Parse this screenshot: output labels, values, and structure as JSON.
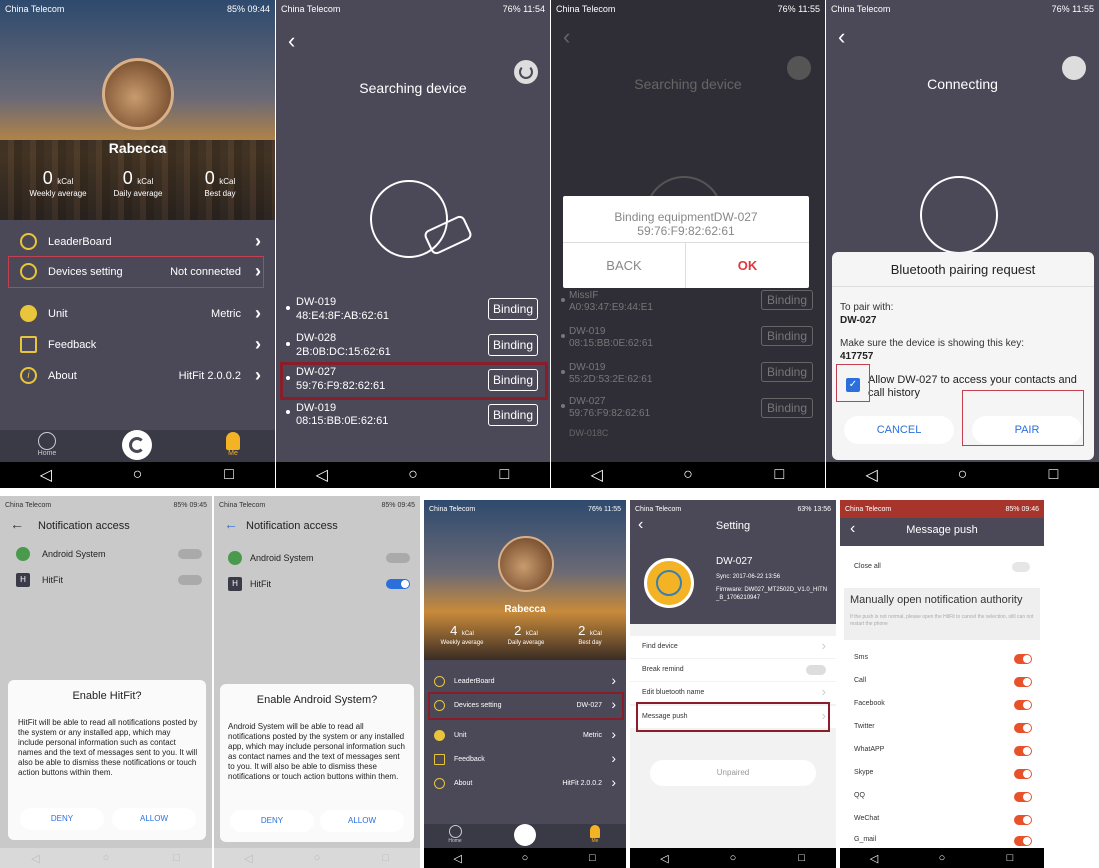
{
  "s1": {
    "status_left": "China Telecom",
    "status_right": "85% 09:44",
    "username": "Rabecca",
    "stats": [
      {
        "value": "0",
        "unit": "kCal",
        "label": "Weekly average"
      },
      {
        "value": "0",
        "unit": "kCal",
        "label": "Daily average"
      },
      {
        "value": "0",
        "unit": "kCal",
        "label": "Best day"
      }
    ],
    "menu": [
      {
        "label": "LeaderBoard",
        "value": ""
      },
      {
        "label": "Devices setting",
        "value": "Not connected"
      },
      {
        "label": "Unit",
        "value": "Metric"
      },
      {
        "label": "Feedback",
        "value": ""
      },
      {
        "label": "About",
        "value": "HitFit 2.0.0.2"
      }
    ],
    "tab_home": "Home",
    "tab_me": "Me"
  },
  "s2": {
    "status_left": "China Telecom",
    "status_right": "76% 11:54",
    "title": "Searching device",
    "binding": "Binding",
    "devices": [
      {
        "name": "DW-019",
        "mac": "48:E4:8F:AB:62:61"
      },
      {
        "name": "DW-028",
        "mac": "2B:0B:DC:15:62:61"
      },
      {
        "name": "DW-027",
        "mac": "59:76:F9:82:62:61"
      },
      {
        "name": "DW-019",
        "mac": "08:15:BB:0E:62:61"
      }
    ]
  },
  "s3": {
    "status_left": "China Telecom",
    "status_right": "76% 11:55",
    "title": "Searching device",
    "dialog_line1": "Binding equipmentDW-027",
    "dialog_line2": "59:76:F9:82:62:61",
    "back": "BACK",
    "ok": "OK",
    "binding": "Binding",
    "devices": [
      {
        "name": "MissIF",
        "mac": "A0:93:47:E9:44:E1"
      },
      {
        "name": "DW-019",
        "mac": "08:15:BB:0E:62:61"
      },
      {
        "name": "DW-019",
        "mac": "55:2D:53:2E:62:61"
      },
      {
        "name": "DW-027",
        "mac": "59:76:F9:82:62:61"
      },
      {
        "name": "DW-018C",
        "mac": ""
      }
    ]
  },
  "s4": {
    "status_left": "China Telecom",
    "status_right": "76% 11:55",
    "title": "Connecting",
    "dialog_title": "Bluetooth pairing request",
    "to_pair": "To pair with:",
    "device": "DW-027",
    "make_sure": "Make sure the device is showing this key:",
    "key": "417757",
    "allow": "Allow DW-027 to access your contacts and call history",
    "cancel": "CANCEL",
    "pair": "PAIR"
  },
  "s5": {
    "status_left": "China Telecom",
    "status_right": "85% 09:45",
    "header": "Notification access",
    "apps": [
      "Android System",
      "HitFit"
    ],
    "dialog_title": "Enable HitFit?",
    "dialog_body": "HitFit will be able to read all notifications posted by the system or any installed app, which may include personal information such as contact names and the text of messages sent to you. It will also be able to dismiss these notifications or touch action buttons within them.",
    "deny": "DENY",
    "allow": "ALLOW"
  },
  "s6": {
    "status_left": "China Telecom",
    "status_right": "85% 09:45",
    "header": "Notification access",
    "apps": [
      "Android System",
      "HitFit"
    ],
    "dialog_title": "Enable Android System?",
    "dialog_body": "Android System will be able to read all notifications posted by the system or any installed app, which may include personal information such as contact names and the text of messages sent to you. It will also be able to dismiss these notifications or touch action buttons within them.",
    "deny": "DENY",
    "allow": "ALLOW"
  },
  "s7": {
    "status_left": "China Telecom",
    "status_right": "76% 11:55",
    "username": "Rabecca",
    "stats": [
      {
        "value": "4",
        "unit": "kCal",
        "label": "Weekly average"
      },
      {
        "value": "2",
        "unit": "kCal",
        "label": "Daily average"
      },
      {
        "value": "2",
        "unit": "kCal",
        "label": "Best day"
      }
    ],
    "menu": [
      {
        "label": "LeaderBoard",
        "value": ""
      },
      {
        "label": "Devices setting",
        "value": "DW-027"
      },
      {
        "label": "Unit",
        "value": "Metric"
      },
      {
        "label": "Feedback",
        "value": ""
      },
      {
        "label": "About",
        "value": "HitFit 2.0.0.2"
      }
    ],
    "tab_home": "Home",
    "tab_me": "Me"
  },
  "s8": {
    "status_left": "China Telecom",
    "status_right": "63% 13:56",
    "title": "Setting",
    "device": "DW-027",
    "sync": "Sync: 2017-06-22 13:56",
    "firmware": "Firmware: DW027_MT2502D_V1.0_HITN_B_1706210947",
    "rows": [
      "Find device",
      "Break remind",
      "Edit bluetooth name",
      "Message push"
    ],
    "unpaired": "Unpaired"
  },
  "s9": {
    "status_left": "China Telecom",
    "status_right": "85% 09:46",
    "title": "Message push",
    "close_all": "Close all",
    "section_title": "Manually open notification authority",
    "section_hint": "If the push is not normal, please open the HitFit to cancel the selection, still can not restart the phone",
    "apps": [
      "Sms",
      "Call",
      "Facebook",
      "Twitter",
      "WhatAPP",
      "Skype",
      "QQ",
      "WeChat",
      "G_mail"
    ]
  },
  "colors": {
    "dark_bg": "#4a4858",
    "accent_red": "#e8522a",
    "android_blue": "#2b6fdc",
    "highlight": "#8b1c2a",
    "ok_red": "#e0363b"
  }
}
